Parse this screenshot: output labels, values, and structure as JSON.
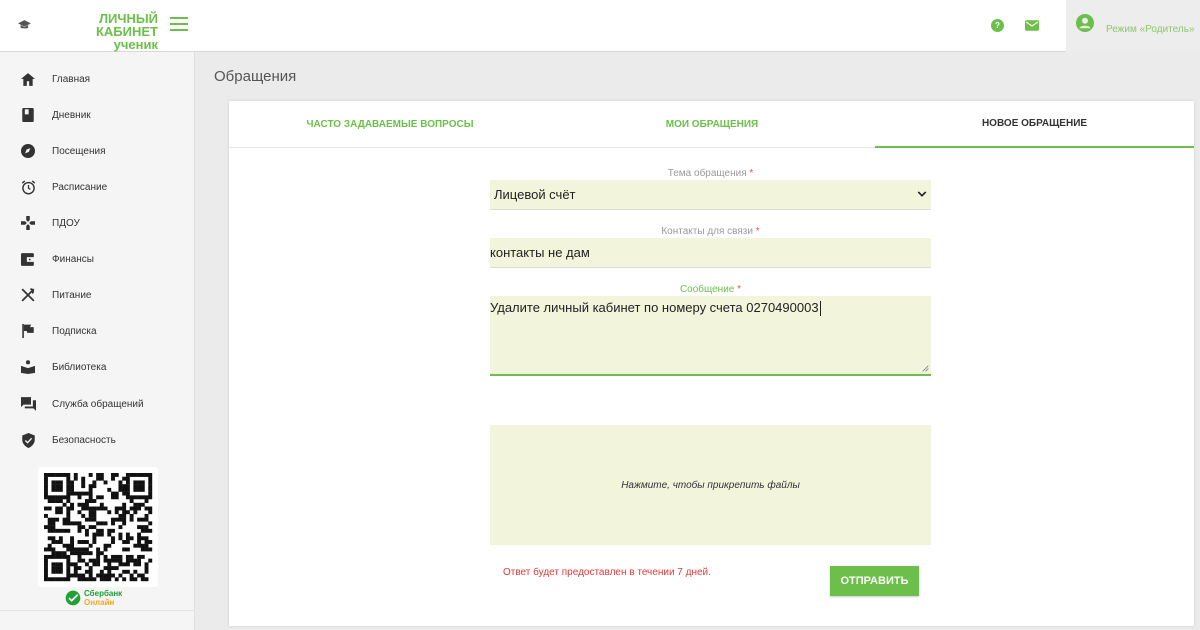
{
  "header": {
    "logo_line1": "ЛИЧНЫЙ КАБИНЕТ",
    "logo_line2": "ученик",
    "profile_label": "Режим «Родитель»",
    "accent_color": "#6cbf4a"
  },
  "sidebar": {
    "items": [
      {
        "label": "Главная",
        "icon": "home-icon"
      },
      {
        "label": "Дневник",
        "icon": "book-icon"
      },
      {
        "label": "Посещения",
        "icon": "explore-icon"
      },
      {
        "label": "Расписание",
        "icon": "alarm-clock-icon"
      },
      {
        "label": "ПДОУ",
        "icon": "gamepad-icon"
      },
      {
        "label": "Финансы",
        "icon": "wallet-icon"
      },
      {
        "label": "Питание",
        "icon": "utensils-icon"
      },
      {
        "label": "Подписка",
        "icon": "flag-icon"
      },
      {
        "label": "Библиотека",
        "icon": "reader-icon"
      },
      {
        "label": "Служба обращений",
        "icon": "chat-icon"
      },
      {
        "label": "Безопасность",
        "icon": "shield-check-icon"
      }
    ],
    "sber_line1": "Сбербанк",
    "sber_line2": "Онлайн"
  },
  "main": {
    "page_title": "Обращения",
    "tabs": [
      {
        "label": "ЧАСТО ЗАДАВАЕМЫЕ ВОПРОСЫ",
        "active": false
      },
      {
        "label": "МОИ ОБРАЩЕНИЯ",
        "active": false
      },
      {
        "label": "НОВОЕ ОБРАЩЕНИЕ",
        "active": true
      }
    ],
    "form": {
      "topic_label": "Тема обращения",
      "topic_value": "Лицевой счёт",
      "contacts_label": "Контакты для связи",
      "contacts_value": "контакты не дам",
      "message_label": "Сообщение",
      "message_value": "Удалите личный кабинет по номеру счета 0270490003",
      "required_mark": "*",
      "attach_label": "Нажмите, чтобы прикрепить файлы",
      "notice": "Ответ будет предоставлен в течении 7 дней.",
      "submit_label": "ОТПРАВИТЬ"
    }
  }
}
